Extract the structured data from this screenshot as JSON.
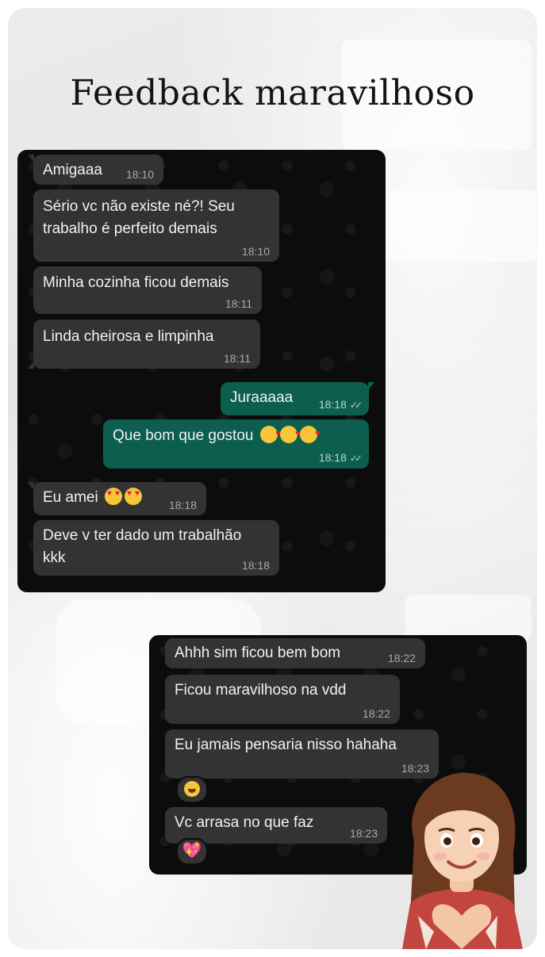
{
  "title": "Feedback maravilhoso",
  "chat1": {
    "messages": [
      {
        "dir": "in",
        "text": "Amigaaa",
        "time": "18:10"
      },
      {
        "dir": "in",
        "text": "Sério vc não existe né?! Seu\ntrabalho é perfeito demais",
        "time": "18:10"
      },
      {
        "dir": "in",
        "text": "Minha cozinha ficou demais",
        "time": "18:11"
      },
      {
        "dir": "in",
        "text": "Linda cheirosa e limpinha",
        "time": "18:11"
      },
      {
        "dir": "out",
        "text": "Juraaaaa",
        "time": "18:18"
      },
      {
        "dir": "out",
        "text": "Que bom que gostou",
        "time": "18:18"
      },
      {
        "dir": "in",
        "text": "Eu amei",
        "time": "18:18"
      },
      {
        "dir": "in",
        "text": "Deve v ter dado um trabalhão\nkkk",
        "time": "18:18"
      }
    ]
  },
  "chat2": {
    "messages": [
      {
        "dir": "in",
        "text": "Ahhh sim ficou bem bom",
        "time": "18:22"
      },
      {
        "dir": "in",
        "text": "Ficou maravilhoso na vdd",
        "time": "18:22"
      },
      {
        "dir": "in",
        "text": "Eu jamais pensaria nisso hahaha",
        "time": "18:23"
      },
      {
        "dir": "in",
        "text": "Vc arrasa no que faz",
        "time": "18:23"
      }
    ]
  },
  "icons": {
    "read_ticks": "double-check-icon",
    "avatar": "memoji-heart-hands"
  },
  "colors": {
    "incoming_bubble": "#333333",
    "outgoing_bubble": "#0c5e4e",
    "chat_background": "#0c0c0c"
  }
}
